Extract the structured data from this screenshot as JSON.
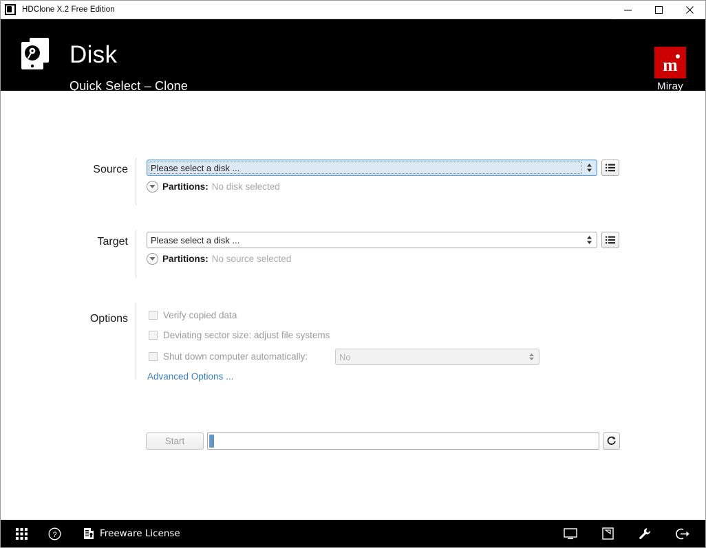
{
  "window": {
    "title": "HDClone X.2 Free Edition",
    "app_icon": "hdclone-app-icon",
    "controls": {
      "minimize": "minimize-icon",
      "maximize": "maximize-icon",
      "close": "close-icon"
    }
  },
  "header": {
    "logo_icon": "disk-stack-icon",
    "title": "Disk",
    "subtitle": "Quick Select – Clone",
    "brand": {
      "mark": "m",
      "name": "Miray",
      "color": "#cc0000"
    }
  },
  "form": {
    "source": {
      "label": "Source",
      "combo_value": "Please select a disk ...",
      "combo_placeholder": "Please select a disk ...",
      "list_button_icon": "list-view-icon",
      "partitions_label": "Partitions:",
      "partitions_value": "No disk selected",
      "expander_icon": "chevron-down-circle-icon",
      "focused": true
    },
    "target": {
      "label": "Target",
      "combo_value": "Please select a disk ...",
      "combo_placeholder": "Please select a disk ...",
      "list_button_icon": "list-view-icon",
      "partitions_label": "Partitions:",
      "partitions_value": "No source selected",
      "expander_icon": "chevron-down-circle-icon",
      "focused": false
    },
    "options": {
      "label": "Options",
      "checkboxes": [
        {
          "label": "Verify copied data",
          "checked": false,
          "enabled": false
        },
        {
          "label": "Deviating sector size: adjust file systems",
          "checked": false,
          "enabled": false
        },
        {
          "label": "Shut down computer automatically:",
          "checked": false,
          "enabled": false
        }
      ],
      "shutdown_select_value": "No",
      "advanced_link": "Advanced Options ..."
    },
    "action": {
      "start_label": "Start",
      "start_enabled": false,
      "progress_percent": 1,
      "progress_color": "#5e90c0",
      "refresh_icon": "refresh-icon"
    }
  },
  "footer": {
    "apps_icon": "grid-apps-icon",
    "help_icon": "help-circle-icon",
    "license_icon": "license-document-icon",
    "license_text": "Freeware License",
    "right_icons": [
      "monitor-icon",
      "screenshot-icon",
      "wrench-icon",
      "exit-icon"
    ]
  },
  "colors": {
    "header_bg": "#000000",
    "brand_red": "#cc0000",
    "link_blue": "#3a7fc1",
    "focus_blue": "#ddeaf6"
  }
}
